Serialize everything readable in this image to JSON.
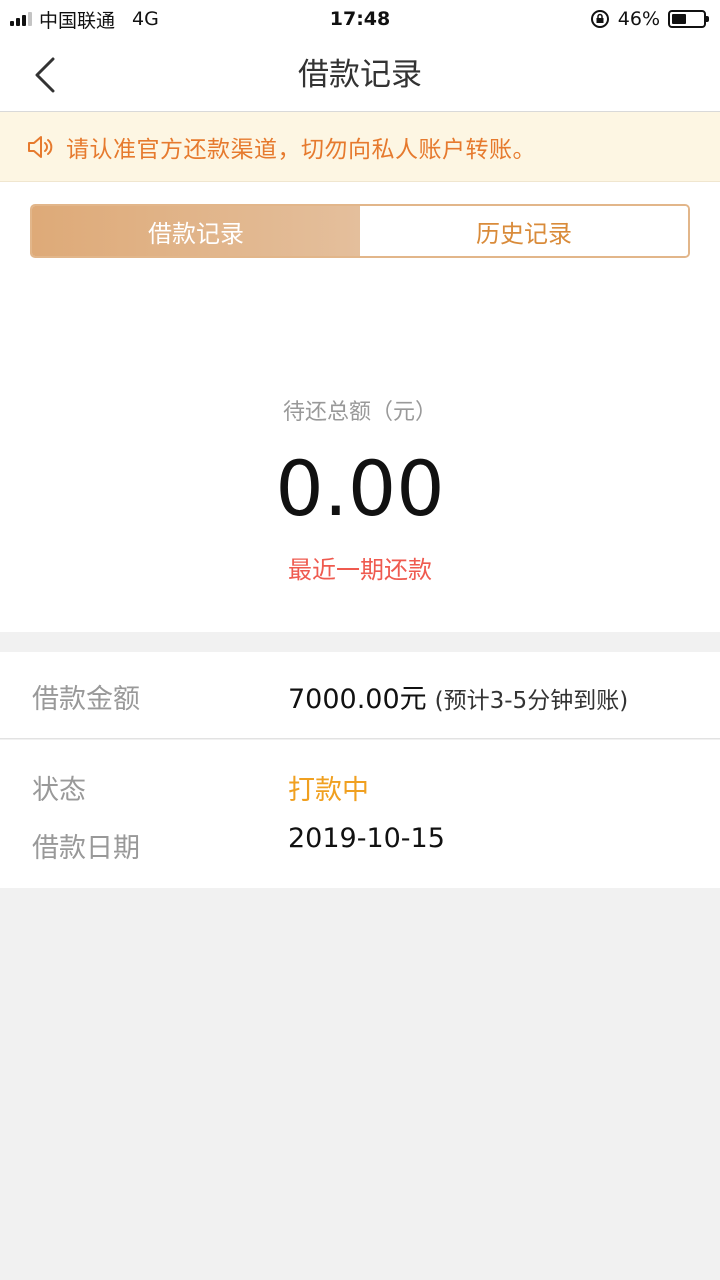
{
  "status_bar": {
    "carrier": "中国联通",
    "network": "4G",
    "time": "17:48",
    "battery": "46%",
    "battery_level": 0.46
  },
  "nav": {
    "title": "借款记录"
  },
  "notice": {
    "text": "请认准官方还款渠道，切勿向私人账户转账。"
  },
  "tabs": [
    {
      "label": "借款记录",
      "active": true
    },
    {
      "label": "历史记录",
      "active": false
    }
  ],
  "summary": {
    "label": "待还总额（元）",
    "amount": "0.00",
    "recent_link": "最近一期还款"
  },
  "details": {
    "amount_label": "借款金额",
    "amount_value": "7000.00元",
    "amount_note": "(预计3-5分钟到账)",
    "status_label": "状态",
    "status_value": "打款中",
    "date_label": "借款日期",
    "date_value": "2019-10-15"
  },
  "colors": {
    "accent": "#deaa78",
    "notice_text": "#e67a2e",
    "link_red": "#ef5a4f",
    "status_orange": "#f0a020"
  }
}
